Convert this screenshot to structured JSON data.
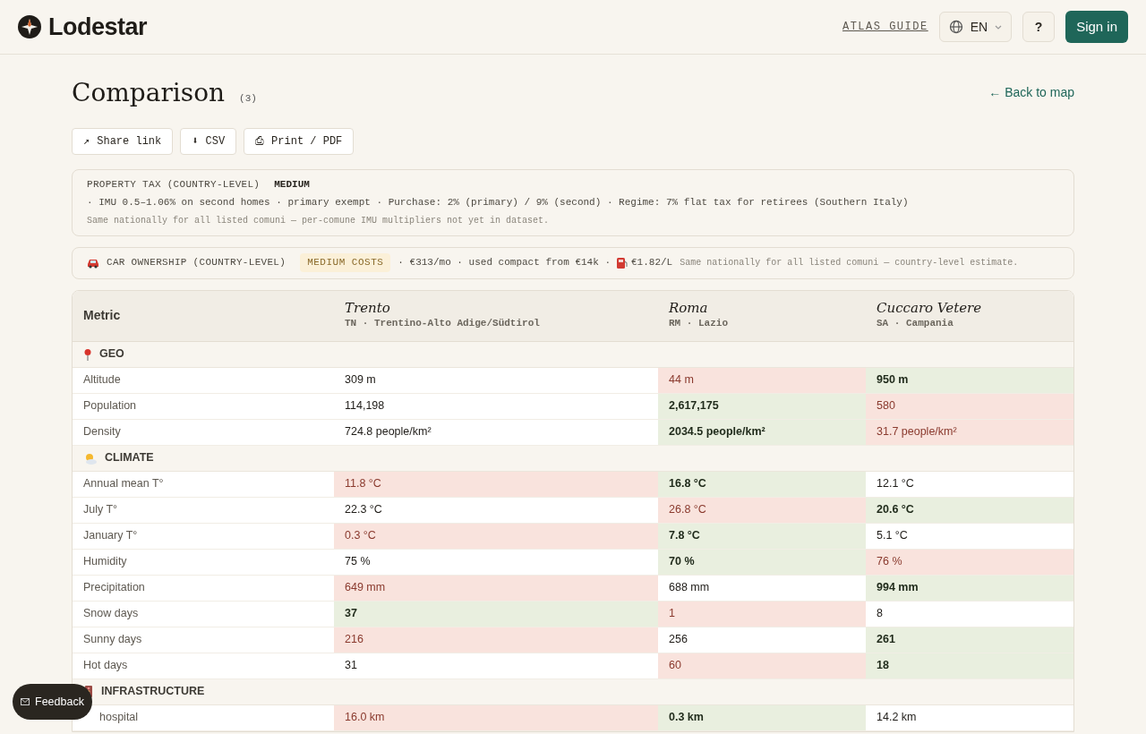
{
  "brand": {
    "name": "Lodestar"
  },
  "nav": {
    "guide": "ATLAS GUIDE",
    "language": "EN",
    "help": "?",
    "sign_in": "Sign in"
  },
  "page": {
    "title": "Comparison",
    "count": "(3)",
    "back_link": "← Back to map"
  },
  "actions": [
    {
      "icon": "↗",
      "label": "Share link"
    },
    {
      "icon": "⬇",
      "label": "CSV"
    },
    {
      "icon": "⎙",
      "label": "Print / PDF"
    }
  ],
  "property_tax": {
    "label": "PROPERTY TAX (COUNTRY-LEVEL)",
    "level": "MEDIUM",
    "details": "· IMU 0.5–1.06% on second homes · primary exempt · Purchase: 2% (primary) / 9% (second) · Regime: 7% flat tax for retirees (Southern Italy)",
    "note": "Same nationally for all listed comuni — per-comune IMU multipliers not yet in dataset."
  },
  "car_ownership": {
    "label": "CAR OWNERSHIP (COUNTRY-LEVEL)",
    "level": "MEDIUM COSTS",
    "details": "· €313/mo · used compact from €14k ·",
    "fuel": "€1.82/L",
    "note": "Same nationally for all listed comuni — country-level estimate."
  },
  "table": {
    "metric_header": "Metric",
    "places": [
      {
        "name": "Trento",
        "region": "TN · Trentino-Alto Adige/Südtirol"
      },
      {
        "name": "Roma",
        "region": "RM · Lazio"
      },
      {
        "name": "Cuccaro Vetere",
        "region": "SA · Campania"
      }
    ],
    "sections": [
      {
        "kind": "geo",
        "title": "GEO",
        "rows": [
          {
            "metric": "Altitude",
            "cells": [
              {
                "value": "309 m",
                "best": false,
                "worst": false
              },
              {
                "value": "44 m",
                "best": false,
                "worst": true
              },
              {
                "value": "950 m",
                "best": true,
                "worst": false
              }
            ]
          },
          {
            "metric": "Population",
            "cells": [
              {
                "value": "114,198",
                "best": false,
                "worst": false
              },
              {
                "value": "2,617,175",
                "best": true,
                "worst": false
              },
              {
                "value": "580",
                "best": false,
                "worst": true
              }
            ]
          },
          {
            "metric": "Density",
            "cells": [
              {
                "value": "724.8 people/km²",
                "best": false,
                "worst": false
              },
              {
                "value": "2034.5 people/km²",
                "best": true,
                "worst": false
              },
              {
                "value": "31.7 people/km²",
                "best": false,
                "worst": true
              }
            ]
          }
        ]
      },
      {
        "kind": "climate",
        "title": "CLIMATE",
        "rows": [
          {
            "metric": "Annual mean T°",
            "cells": [
              {
                "value": "11.8 °C",
                "best": false,
                "worst": true
              },
              {
                "value": "16.8 °C",
                "best": true,
                "worst": false
              },
              {
                "value": "12.1 °C",
                "best": false,
                "worst": false
              }
            ]
          },
          {
            "metric": "July T°",
            "cells": [
              {
                "value": "22.3 °C",
                "best": false,
                "worst": false
              },
              {
                "value": "26.8 °C",
                "best": false,
                "worst": true
              },
              {
                "value": "20.6 °C",
                "best": true,
                "worst": false
              }
            ]
          },
          {
            "metric": "January T°",
            "cells": [
              {
                "value": "0.3 °C",
                "best": false,
                "worst": true
              },
              {
                "value": "7.8 °C",
                "best": true,
                "worst": false
              },
              {
                "value": "5.1 °C",
                "best": false,
                "worst": false
              }
            ]
          },
          {
            "metric": "Humidity",
            "cells": [
              {
                "value": "75 %",
                "best": false,
                "worst": false
              },
              {
                "value": "70 %",
                "best": true,
                "worst": false
              },
              {
                "value": "76 %",
                "best": false,
                "worst": true
              }
            ]
          },
          {
            "metric": "Precipitation",
            "cells": [
              {
                "value": "649 mm",
                "best": false,
                "worst": true
              },
              {
                "value": "688 mm",
                "best": false,
                "worst": false
              },
              {
                "value": "994 mm",
                "best": true,
                "worst": false
              }
            ]
          },
          {
            "metric": "Snow days",
            "cells": [
              {
                "value": "37",
                "best": true,
                "worst": false
              },
              {
                "value": "1",
                "best": false,
                "worst": true
              },
              {
                "value": "8",
                "best": false,
                "worst": false
              }
            ]
          },
          {
            "metric": "Sunny days",
            "cells": [
              {
                "value": "216",
                "best": false,
                "worst": true
              },
              {
                "value": "256",
                "best": false,
                "worst": false
              },
              {
                "value": "261",
                "best": true,
                "worst": false
              }
            ]
          },
          {
            "metric": "Hot days",
            "cells": [
              {
                "value": "31",
                "best": false,
                "worst": false
              },
              {
                "value": "60",
                "best": false,
                "worst": true
              },
              {
                "value": "18",
                "best": true,
                "worst": false
              }
            ]
          }
        ]
      },
      {
        "kind": "infrastructure",
        "title": "INFRASTRUCTURE",
        "rows": [
          {
            "metric": "hospital",
            "cells": [
              {
                "value": "16.0 km",
                "best": false,
                "worst": true
              },
              {
                "value": "0.3 km",
                "best": true,
                "worst": false
              },
              {
                "value": "14.2 km",
                "best": false,
                "worst": false
              }
            ]
          }
        ]
      }
    ]
  },
  "feedback": {
    "label": "Feedback"
  }
}
